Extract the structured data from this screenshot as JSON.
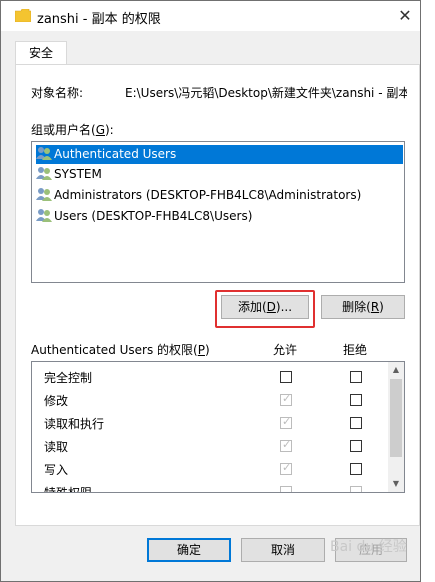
{
  "window": {
    "title": "zanshi - 副本 的权限",
    "close_glyph": "✕",
    "tab_label": "安全"
  },
  "object": {
    "label": "对象名称:",
    "path": "E:\\Users\\冯元韬\\Desktop\\新建文件夹\\zanshi - 副本"
  },
  "groups": {
    "label_prefix": "组或用户名(",
    "label_key": "G",
    "label_suffix": "):",
    "items": [
      {
        "name": "Authenticated Users",
        "selected": true
      },
      {
        "name": "SYSTEM",
        "selected": false
      },
      {
        "name": "Administrators (DESKTOP-FHB4LC8\\Administrators)",
        "selected": false
      },
      {
        "name": "Users (DESKTOP-FHB4LC8\\Users)",
        "selected": false
      }
    ]
  },
  "buttons": {
    "add_prefix": "添加(",
    "add_key": "D",
    "add_suffix": ")...",
    "remove_prefix": "删除(",
    "remove_key": "R",
    "remove_suffix": ")",
    "ok": "确定",
    "cancel": "取消",
    "apply": "应用"
  },
  "permissions": {
    "header_prefix": "Authenticated Users 的权限(",
    "header_key": "P",
    "header_suffix": ")",
    "allow_label": "允许",
    "deny_label": "拒绝",
    "rows": [
      {
        "name": "完全控制",
        "allow": false,
        "allow_inherited": false,
        "deny": false
      },
      {
        "name": "修改",
        "allow": true,
        "allow_inherited": true,
        "deny": false
      },
      {
        "name": "读取和执行",
        "allow": true,
        "allow_inherited": true,
        "deny": false
      },
      {
        "name": "读取",
        "allow": true,
        "allow_inherited": true,
        "deny": false
      },
      {
        "name": "写入",
        "allow": true,
        "allow_inherited": true,
        "deny": false
      },
      {
        "name": "特殊权限",
        "allow": false,
        "allow_inherited": true,
        "deny": false
      }
    ],
    "check_glyph": "✓"
  },
  "watermark": "Bai du 经验"
}
